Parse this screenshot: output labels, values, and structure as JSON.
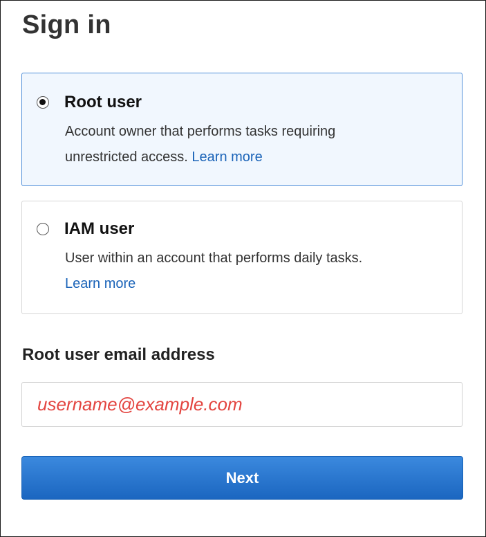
{
  "page": {
    "title": "Sign in"
  },
  "options": [
    {
      "label": "Root user",
      "description_line1": "Account owner that performs tasks requiring",
      "description_line2": "unrestricted access.",
      "link": "Learn more",
      "selected": true
    },
    {
      "label": "IAM user",
      "description_line1": "User within an account that performs daily tasks.",
      "link": "Learn more",
      "selected": false
    }
  ],
  "email": {
    "label": "Root user email address",
    "value": "username@example.com"
  },
  "next_button": {
    "label": "Next"
  },
  "colors": {
    "selected_option_bg": "#f1f7fe",
    "selected_option_border": "#4f8ed9",
    "link": "#1a63b8",
    "email_text": "#e3443f",
    "button_bg": "#1b66c0"
  }
}
